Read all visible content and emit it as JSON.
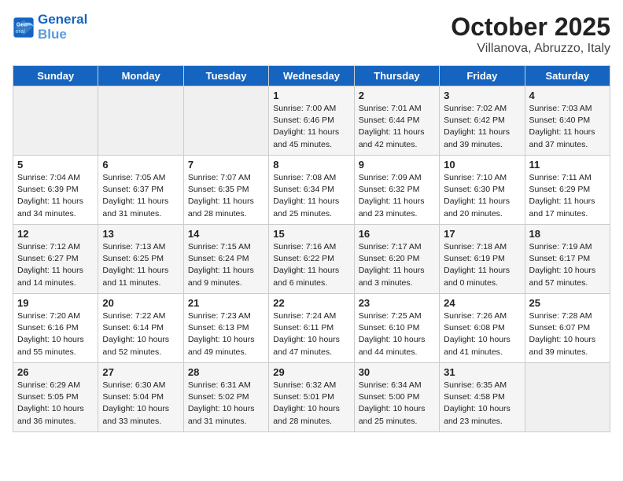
{
  "header": {
    "logo_line1": "General",
    "logo_line2": "Blue",
    "month": "October 2025",
    "location": "Villanova, Abruzzo, Italy"
  },
  "weekdays": [
    "Sunday",
    "Monday",
    "Tuesday",
    "Wednesday",
    "Thursday",
    "Friday",
    "Saturday"
  ],
  "weeks": [
    [
      {
        "day": "",
        "info": ""
      },
      {
        "day": "",
        "info": ""
      },
      {
        "day": "",
        "info": ""
      },
      {
        "day": "1",
        "info": "Sunrise: 7:00 AM\nSunset: 6:46 PM\nDaylight: 11 hours\nand 45 minutes."
      },
      {
        "day": "2",
        "info": "Sunrise: 7:01 AM\nSunset: 6:44 PM\nDaylight: 11 hours\nand 42 minutes."
      },
      {
        "day": "3",
        "info": "Sunrise: 7:02 AM\nSunset: 6:42 PM\nDaylight: 11 hours\nand 39 minutes."
      },
      {
        "day": "4",
        "info": "Sunrise: 7:03 AM\nSunset: 6:40 PM\nDaylight: 11 hours\nand 37 minutes."
      }
    ],
    [
      {
        "day": "5",
        "info": "Sunrise: 7:04 AM\nSunset: 6:39 PM\nDaylight: 11 hours\nand 34 minutes."
      },
      {
        "day": "6",
        "info": "Sunrise: 7:05 AM\nSunset: 6:37 PM\nDaylight: 11 hours\nand 31 minutes."
      },
      {
        "day": "7",
        "info": "Sunrise: 7:07 AM\nSunset: 6:35 PM\nDaylight: 11 hours\nand 28 minutes."
      },
      {
        "day": "8",
        "info": "Sunrise: 7:08 AM\nSunset: 6:34 PM\nDaylight: 11 hours\nand 25 minutes."
      },
      {
        "day": "9",
        "info": "Sunrise: 7:09 AM\nSunset: 6:32 PM\nDaylight: 11 hours\nand 23 minutes."
      },
      {
        "day": "10",
        "info": "Sunrise: 7:10 AM\nSunset: 6:30 PM\nDaylight: 11 hours\nand 20 minutes."
      },
      {
        "day": "11",
        "info": "Sunrise: 7:11 AM\nSunset: 6:29 PM\nDaylight: 11 hours\nand 17 minutes."
      }
    ],
    [
      {
        "day": "12",
        "info": "Sunrise: 7:12 AM\nSunset: 6:27 PM\nDaylight: 11 hours\nand 14 minutes."
      },
      {
        "day": "13",
        "info": "Sunrise: 7:13 AM\nSunset: 6:25 PM\nDaylight: 11 hours\nand 11 minutes."
      },
      {
        "day": "14",
        "info": "Sunrise: 7:15 AM\nSunset: 6:24 PM\nDaylight: 11 hours\nand 9 minutes."
      },
      {
        "day": "15",
        "info": "Sunrise: 7:16 AM\nSunset: 6:22 PM\nDaylight: 11 hours\nand 6 minutes."
      },
      {
        "day": "16",
        "info": "Sunrise: 7:17 AM\nSunset: 6:20 PM\nDaylight: 11 hours\nand 3 minutes."
      },
      {
        "day": "17",
        "info": "Sunrise: 7:18 AM\nSunset: 6:19 PM\nDaylight: 11 hours\nand 0 minutes."
      },
      {
        "day": "18",
        "info": "Sunrise: 7:19 AM\nSunset: 6:17 PM\nDaylight: 10 hours\nand 57 minutes."
      }
    ],
    [
      {
        "day": "19",
        "info": "Sunrise: 7:20 AM\nSunset: 6:16 PM\nDaylight: 10 hours\nand 55 minutes."
      },
      {
        "day": "20",
        "info": "Sunrise: 7:22 AM\nSunset: 6:14 PM\nDaylight: 10 hours\nand 52 minutes."
      },
      {
        "day": "21",
        "info": "Sunrise: 7:23 AM\nSunset: 6:13 PM\nDaylight: 10 hours\nand 49 minutes."
      },
      {
        "day": "22",
        "info": "Sunrise: 7:24 AM\nSunset: 6:11 PM\nDaylight: 10 hours\nand 47 minutes."
      },
      {
        "day": "23",
        "info": "Sunrise: 7:25 AM\nSunset: 6:10 PM\nDaylight: 10 hours\nand 44 minutes."
      },
      {
        "day": "24",
        "info": "Sunrise: 7:26 AM\nSunset: 6:08 PM\nDaylight: 10 hours\nand 41 minutes."
      },
      {
        "day": "25",
        "info": "Sunrise: 7:28 AM\nSunset: 6:07 PM\nDaylight: 10 hours\nand 39 minutes."
      }
    ],
    [
      {
        "day": "26",
        "info": "Sunrise: 6:29 AM\nSunset: 5:05 PM\nDaylight: 10 hours\nand 36 minutes."
      },
      {
        "day": "27",
        "info": "Sunrise: 6:30 AM\nSunset: 5:04 PM\nDaylight: 10 hours\nand 33 minutes."
      },
      {
        "day": "28",
        "info": "Sunrise: 6:31 AM\nSunset: 5:02 PM\nDaylight: 10 hours\nand 31 minutes."
      },
      {
        "day": "29",
        "info": "Sunrise: 6:32 AM\nSunset: 5:01 PM\nDaylight: 10 hours\nand 28 minutes."
      },
      {
        "day": "30",
        "info": "Sunrise: 6:34 AM\nSunset: 5:00 PM\nDaylight: 10 hours\nand 25 minutes."
      },
      {
        "day": "31",
        "info": "Sunrise: 6:35 AM\nSunset: 4:58 PM\nDaylight: 10 hours\nand 23 minutes."
      },
      {
        "day": "",
        "info": ""
      }
    ]
  ]
}
